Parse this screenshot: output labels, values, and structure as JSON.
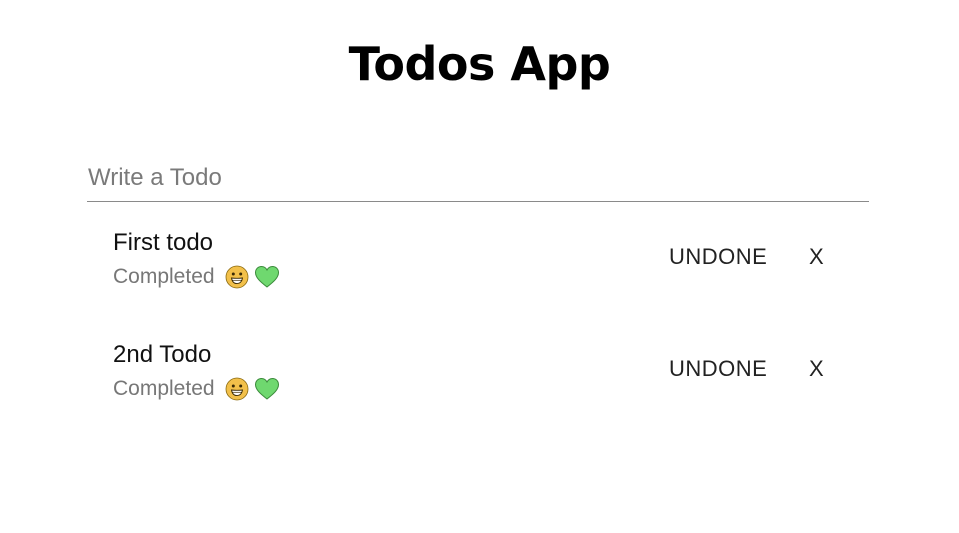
{
  "app": {
    "title": "Todos App"
  },
  "input": {
    "placeholder": "Write a Todo",
    "value": ""
  },
  "todos": [
    {
      "text": "First todo",
      "status": "Completed",
      "status_icons": [
        "grinning-face-icon",
        "green-heart-icon"
      ],
      "toggle_label": "UNDONE",
      "delete_label": "X"
    },
    {
      "text": "2nd Todo",
      "status": "Completed",
      "status_icons": [
        "grinning-face-icon",
        "green-heart-icon"
      ],
      "toggle_label": "UNDONE",
      "delete_label": "X"
    }
  ],
  "colors": {
    "title": "#000000",
    "placeholder": "#7a7a7a",
    "status_text": "#777777",
    "heart": "#6fd86f",
    "smiley": "#f2c04a"
  }
}
